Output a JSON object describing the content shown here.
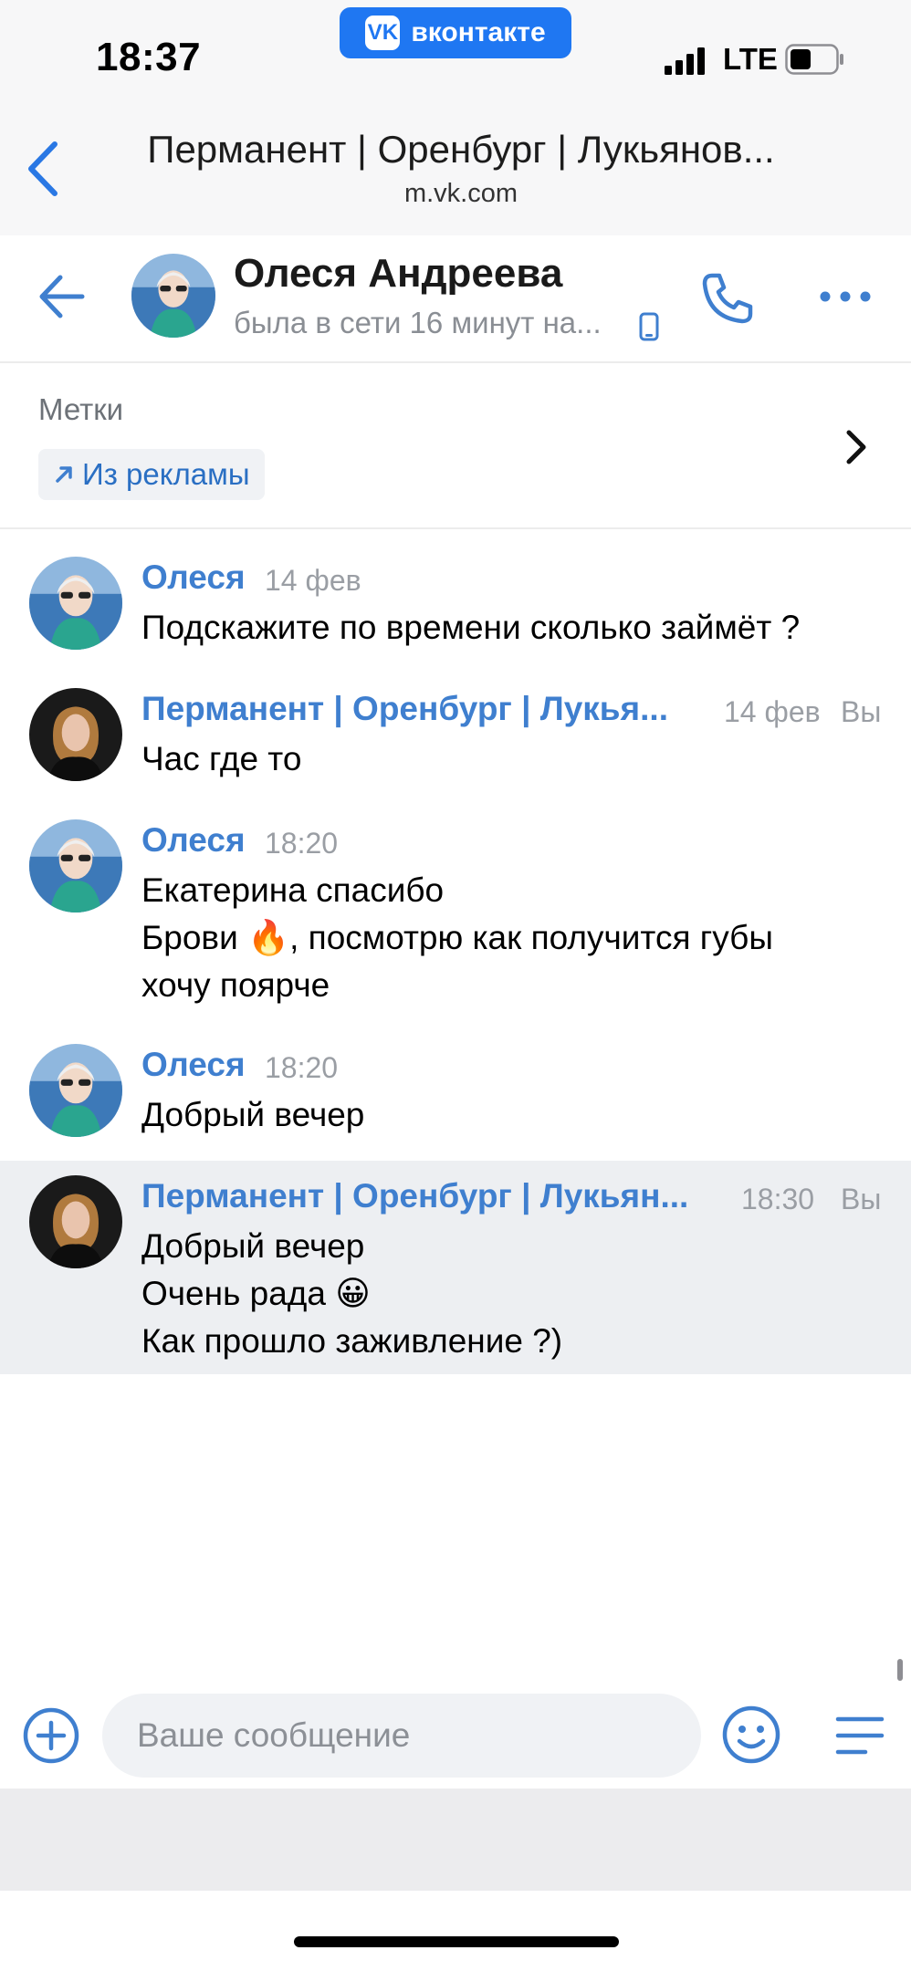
{
  "status_bar": {
    "time": "18:37",
    "app_badge": "вконтакте",
    "network": "LTE"
  },
  "browser": {
    "title": "Перманент | Оренбург | Лукьянов...",
    "url": "m.vk.com"
  },
  "chat_header": {
    "name": "Олеся Андреева",
    "status": "была в сети 16 минут на..."
  },
  "labels": {
    "title": "Метки",
    "tag": "Из рекламы"
  },
  "messages": [
    {
      "author": "Олеся",
      "time": "14 фев",
      "you": "",
      "lines": [
        "Подскажите по времени сколько займёт ?"
      ]
    },
    {
      "author": "Перманент | Оренбург | Лукья...",
      "time": "14 фев",
      "you": "Вы",
      "lines": [
        "Час где то"
      ]
    },
    {
      "author": "Олеся",
      "time": "18:20",
      "you": "",
      "lines": [
        "Екатерина спасибо",
        "Брови 🔥, посмотрю как получится губы",
        "хочу поярче"
      ]
    },
    {
      "author": "Олеся",
      "time": "18:20",
      "you": "",
      "lines": [
        "Добрый вечер"
      ]
    },
    {
      "author": "Перманент | Оренбург | Лукьян...",
      "time": "18:30",
      "you": "Вы",
      "lines": [
        "Добрый вечер",
        "Очень рада 😀",
        "Как прошло заживление ?)"
      ]
    }
  ],
  "composer": {
    "placeholder": "Ваше сообщение"
  },
  "colors": {
    "accent": "#3f7fcf",
    "vk_blue": "#1f77f2",
    "highlight_row": "#edeff2"
  },
  "icons": [
    "chevron-left-icon",
    "arrow-back-icon",
    "phone-icon",
    "more-icon",
    "arrow-up-right-icon",
    "chevron-right-icon",
    "add-icon",
    "smile-icon",
    "menu-icon",
    "mobile-icon"
  ]
}
